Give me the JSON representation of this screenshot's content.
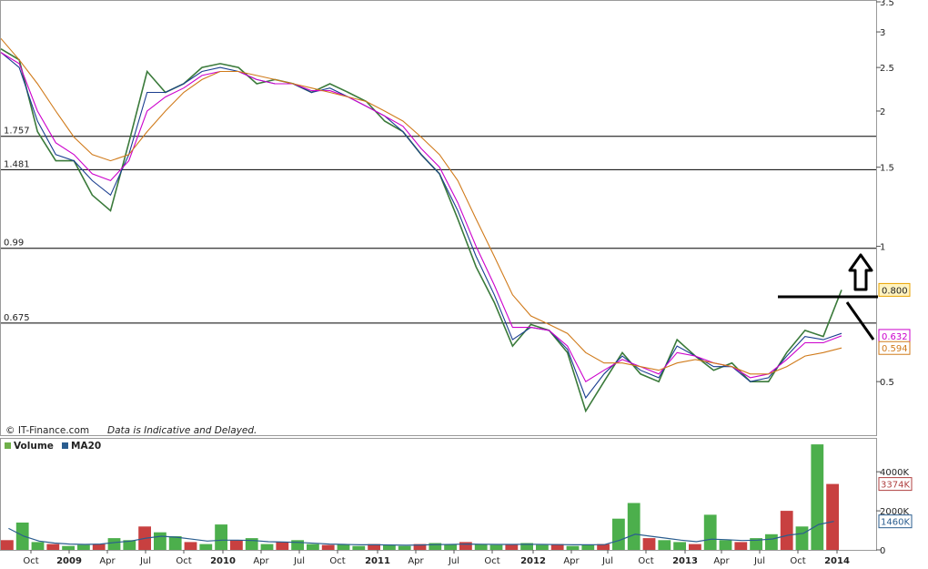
{
  "chart_data": [
    {
      "type": "line",
      "title": "",
      "watermark": "© IT-Finance.com",
      "disclaimer": "Data is Indicative and Delayed.",
      "ylim": [
        0.38,
        3.5
      ],
      "y_scale": "log",
      "yticks": [
        "3.5",
        "3",
        "2.5",
        "2",
        "1.5",
        "1",
        "0.5"
      ],
      "hlines": [
        {
          "label": "1.757",
          "value": 1.757
        },
        {
          "label": "1.481",
          "value": 1.481
        },
        {
          "label": "0.99",
          "value": 0.99
        },
        {
          "label": "0.675",
          "value": 0.675
        }
      ],
      "price_tags": [
        {
          "label": "0.800",
          "value": 0.8,
          "color": "#e8a300"
        },
        {
          "label": "0.632",
          "value": 0.632,
          "color": "#cc00cc"
        },
        {
          "label": "0.594",
          "value": 0.594,
          "color": "#d07a1a"
        }
      ],
      "x_ticks": [
        "Oct",
        "2009",
        "Apr",
        "Jul",
        "Oct",
        "2010",
        "Apr",
        "Jul",
        "Oct",
        "2011",
        "Apr",
        "Jul",
        "Oct",
        "2012",
        "Apr",
        "Jul",
        "Oct",
        "2013",
        "Apr",
        "Jul",
        "Oct",
        "2014"
      ],
      "series": [
        {
          "name": "",
          "color": "#3a7a3a",
          "values": [
            2.75,
            2.6,
            1.8,
            1.55,
            1.55,
            1.3,
            1.2,
            1.7,
            2.45,
            2.2,
            2.3,
            2.5,
            2.55,
            2.5,
            2.3,
            2.35,
            2.3,
            2.2,
            2.3,
            2.2,
            2.1,
            1.9,
            1.8,
            1.6,
            1.45,
            1.15,
            0.9,
            0.75,
            0.6,
            0.67,
            0.65,
            0.58,
            0.43,
            0.5,
            0.58,
            0.52,
            0.5,
            0.62,
            0.57,
            0.53,
            0.55,
            0.5,
            0.5,
            0.58,
            0.65,
            0.63,
            0.8
          ]
        },
        {
          "name": "",
          "color": "#1a3d8f",
          "values": [
            2.7,
            2.5,
            1.9,
            1.6,
            1.55,
            1.4,
            1.3,
            1.6,
            2.2,
            2.2,
            2.3,
            2.45,
            2.5,
            2.45,
            2.35,
            2.3,
            2.3,
            2.2,
            2.25,
            2.15,
            2.05,
            1.95,
            1.8,
            1.6,
            1.45,
            1.2,
            0.95,
            0.78,
            0.62,
            0.66,
            0.65,
            0.59,
            0.46,
            0.52,
            0.57,
            0.53,
            0.51,
            0.6,
            0.57,
            0.54,
            0.54,
            0.5,
            0.51,
            0.57,
            0.63,
            0.62,
            0.64
          ]
        },
        {
          "name": "",
          "color": "#cc00cc",
          "values": [
            2.7,
            2.55,
            2.0,
            1.7,
            1.6,
            1.45,
            1.4,
            1.55,
            2.0,
            2.15,
            2.25,
            2.4,
            2.45,
            2.45,
            2.35,
            2.3,
            2.3,
            2.22,
            2.22,
            2.15,
            2.05,
            1.95,
            1.85,
            1.65,
            1.5,
            1.25,
            1.0,
            0.82,
            0.66,
            0.66,
            0.65,
            0.6,
            0.5,
            0.53,
            0.56,
            0.54,
            0.52,
            0.58,
            0.57,
            0.55,
            0.54,
            0.51,
            0.52,
            0.56,
            0.61,
            0.61,
            0.632
          ]
        },
        {
          "name": "",
          "color": "#d07a1a",
          "values": [
            2.9,
            2.6,
            2.3,
            2.0,
            1.75,
            1.6,
            1.55,
            1.6,
            1.8,
            2.0,
            2.2,
            2.35,
            2.45,
            2.45,
            2.4,
            2.35,
            2.3,
            2.25,
            2.2,
            2.15,
            2.1,
            2.0,
            1.9,
            1.75,
            1.6,
            1.4,
            1.15,
            0.95,
            0.78,
            0.7,
            0.67,
            0.64,
            0.58,
            0.55,
            0.55,
            0.54,
            0.53,
            0.55,
            0.56,
            0.55,
            0.54,
            0.52,
            0.52,
            0.54,
            0.57,
            0.58,
            0.594
          ]
        }
      ]
    },
    {
      "type": "bar",
      "title": "",
      "legend": [
        "Volume",
        "MA20"
      ],
      "legend_colors": [
        "#6fb04a",
        "#2a5d8f"
      ],
      "yticks": [
        "4000K",
        "2000K",
        "0"
      ],
      "ylim": [
        0,
        5500
      ],
      "price_tags": [
        {
          "label": "3374K",
          "value": 3374,
          "color": "#b04040"
        },
        {
          "label": "1460K",
          "value": 1460,
          "color": "#2a5d8f"
        }
      ],
      "series": [
        {
          "name": "Volume",
          "values": [
            500,
            1400,
            400,
            300,
            200,
            250,
            300,
            600,
            500,
            1200,
            900,
            700,
            400,
            300,
            1300,
            500,
            600,
            300,
            400,
            500,
            300,
            250,
            300,
            200,
            300,
            250,
            200,
            300,
            350,
            300,
            400,
            300,
            250,
            300,
            350,
            250,
            300,
            200,
            250,
            300,
            1600,
            2400,
            600,
            500,
            400,
            300,
            1800,
            500,
            400,
            600,
            800,
            2000,
            1200,
            5400,
            3374
          ]
        },
        {
          "name": "MA20",
          "values": [
            1100,
            700,
            450,
            350,
            300,
            280,
            300,
            380,
            450,
            600,
            700,
            650,
            550,
            450,
            500,
            500,
            480,
            420,
            400,
            380,
            340,
            300,
            280,
            260,
            260,
            250,
            240,
            250,
            270,
            280,
            300,
            290,
            280,
            280,
            290,
            280,
            270,
            260,
            260,
            270,
            500,
            800,
            700,
            600,
            500,
            420,
            550,
            520,
            480,
            500,
            560,
            750,
            850,
            1300,
            1460
          ]
        }
      ]
    }
  ]
}
